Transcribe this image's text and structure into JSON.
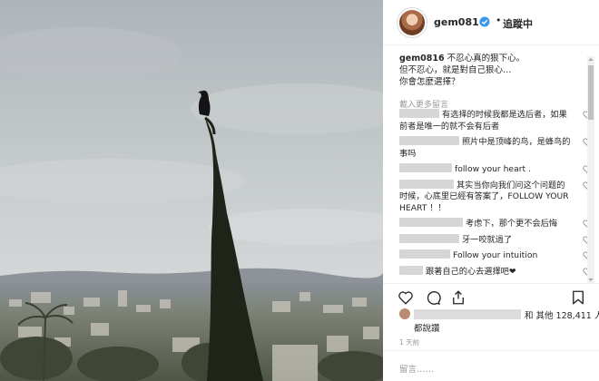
{
  "header": {
    "username": "gem0816",
    "separator": "•",
    "follow_status": "追蹤中",
    "icons": {
      "avatar": "profile-avatar",
      "verified": "verified-badge-icon"
    }
  },
  "caption": {
    "username": "gem0816",
    "lines": [
      "不忍心真的狠下心。",
      "但不忍心，就是對自己狠心…",
      "你會怎麼選擇？"
    ]
  },
  "load_more_comments": "載入更多留言",
  "comments": [
    {
      "text": "有选择的时候我都是选后者，如果前者是唯一的就不会有后者"
    },
    {
      "text": "照片中是顶峰的鸟，是蜂鸟的事吗"
    },
    {
      "text": "follow your heart ."
    },
    {
      "text": "其实当你向我们问这个问题的时候，心底里已經有答案了，FOLLOW YOUR HEART ！！"
    },
    {
      "text": "考虑下，那个更不会后悔"
    },
    {
      "text": "牙一咬就過了"
    },
    {
      "text": "Follow your intuition"
    },
    {
      "text": "跟著自己的心去選擇吧❤"
    }
  ],
  "actions": {
    "icons": [
      "heart-icon",
      "comment-icon",
      "share-icon",
      "bookmark-icon"
    ]
  },
  "likes": {
    "text": "和 其他 128,411 人",
    "line2": "都說讚"
  },
  "timestamp": "1 天前",
  "comment_input": {
    "placeholder": "留言……"
  },
  "colors": {
    "verified": "#3897f0",
    "text": "#262626",
    "muted": "#999999"
  }
}
